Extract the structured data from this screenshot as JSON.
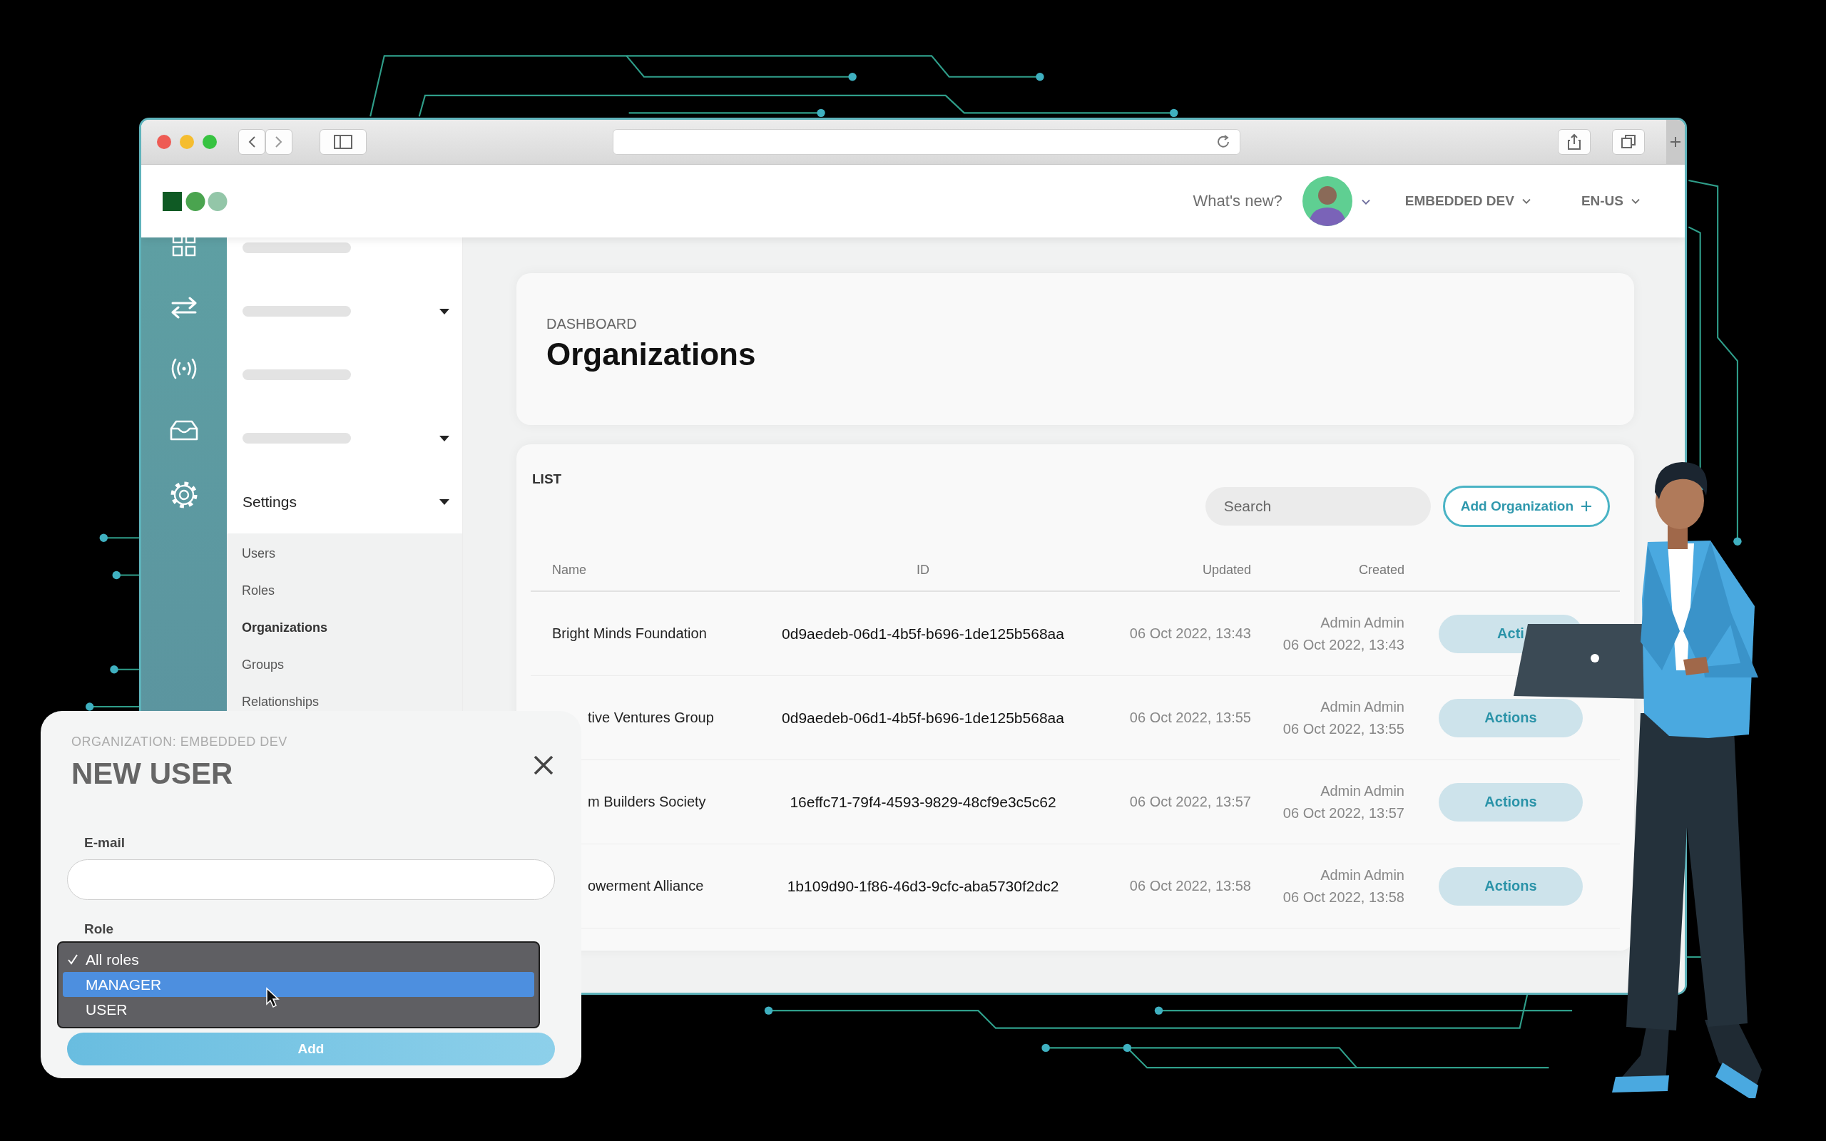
{
  "header": {
    "whats_new": "What's new?",
    "account_menu": "EMBEDDED DEV",
    "language_menu": "EN-US"
  },
  "sidebar": {
    "items": [
      {
        "kind": "skeleton",
        "expandable": false
      },
      {
        "kind": "skeleton",
        "expandable": true
      },
      {
        "kind": "skeleton",
        "expandable": false
      },
      {
        "kind": "skeleton",
        "expandable": true
      },
      {
        "kind": "section",
        "label": "Settings",
        "expandable": true,
        "expanded": true,
        "children": [
          {
            "label": "Users",
            "selected": false
          },
          {
            "label": "Roles",
            "selected": false
          },
          {
            "label": "Organizations",
            "selected": true
          },
          {
            "label": "Groups",
            "selected": false
          },
          {
            "label": "Relationships",
            "selected": false
          }
        ]
      }
    ]
  },
  "page": {
    "breadcrumb": "DASHBOARD",
    "title": "Organizations"
  },
  "list": {
    "title": "LIST",
    "search": {
      "placeholder": "Search"
    },
    "add_button": "Add Organization",
    "columns": [
      "Name",
      "ID",
      "Updated",
      "Created"
    ],
    "rows": [
      {
        "name": "Bright Minds Foundation",
        "cut_off": false,
        "id": "0d9aedeb-06d1-4b5f-b696-1de125b568aa",
        "updated": "06 Oct 2022, 13:43",
        "created_by": "Admin Admin",
        "created": "06 Oct 2022, 13:43",
        "action": "Acti"
      },
      {
        "name": "tive Ventures Group",
        "cut_off": true,
        "id": "0d9aedeb-06d1-4b5f-b696-1de125b568aa",
        "updated": "06 Oct 2022, 13:55",
        "created_by": "Admin Admin",
        "created": "06 Oct 2022, 13:55",
        "action": "Actions"
      },
      {
        "name": "m Builders Society",
        "cut_off": true,
        "id": "16effc71-79f4-4593-9829-48cf9e3c5c62",
        "updated": "06 Oct 2022, 13:57",
        "created_by": "Admin Admin",
        "created": "06 Oct 2022, 13:57",
        "action": "Actions"
      },
      {
        "name": "owerment Alliance",
        "cut_off": true,
        "id": "1b109d90-1f86-46d3-9cfc-aba5730f2dc2",
        "updated": "06 Oct 2022, 13:58",
        "created_by": "Admin Admin",
        "created": "06 Oct 2022, 13:58",
        "action": "Actions"
      }
    ]
  },
  "modal": {
    "subtitle": "ORGANIZATION: EMBEDDED DEV",
    "title": "NEW USER",
    "email_label": "E-mail",
    "role_label": "Role",
    "role_options": [
      {
        "label": "All roles",
        "checked": true,
        "selected": false
      },
      {
        "label": "MANAGER",
        "checked": false,
        "selected": true
      },
      {
        "label": "USER",
        "checked": false,
        "selected": false
      }
    ],
    "submit": "Add"
  }
}
